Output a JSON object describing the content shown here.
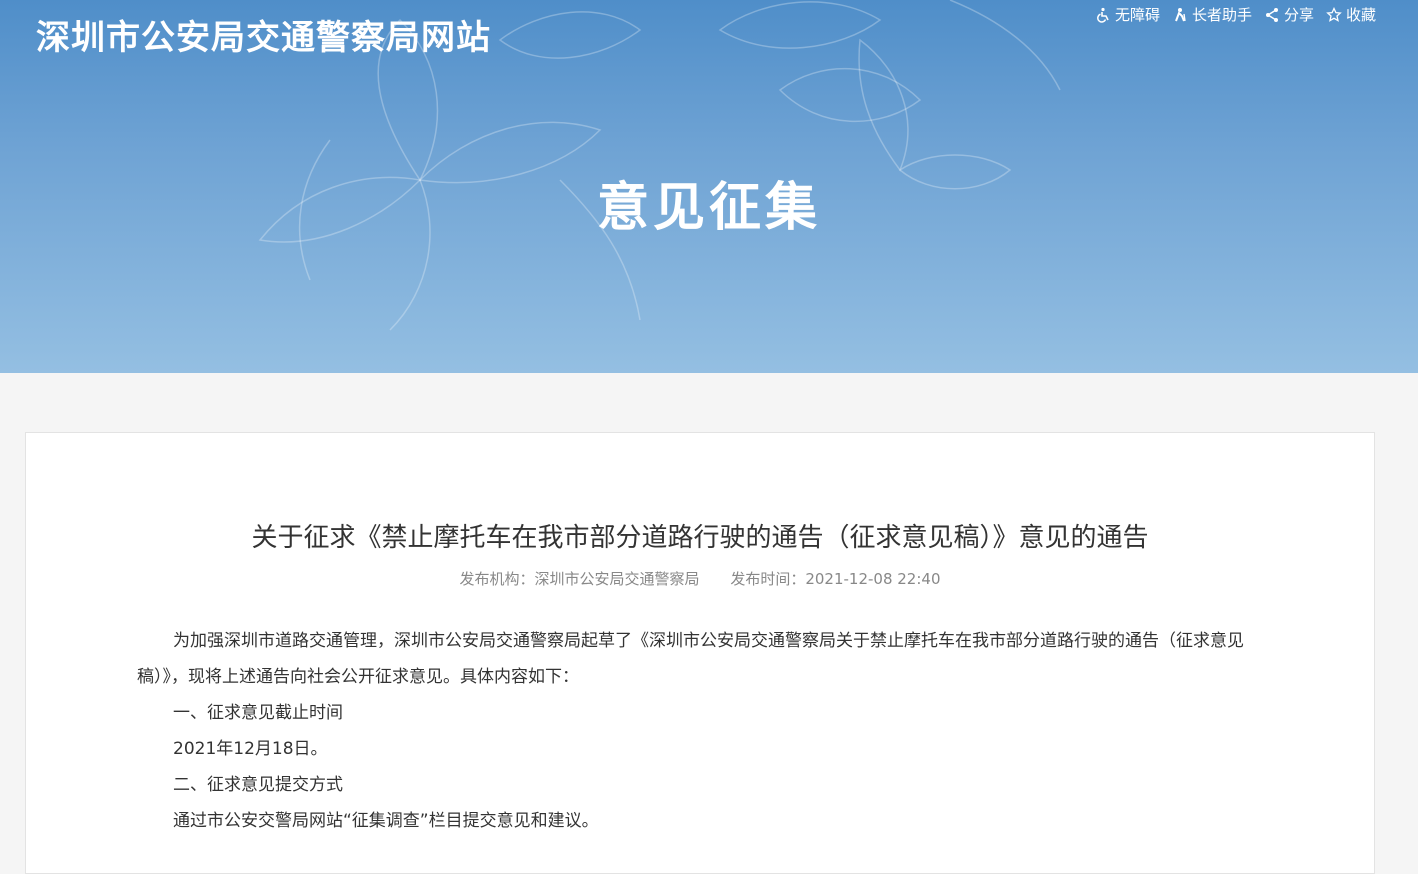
{
  "header": {
    "site_title": "深圳市公安局交通警察局网站",
    "banner_heading": "意见征集",
    "toolbar": [
      {
        "label": "无障碍",
        "icon": "wheelchair-icon"
      },
      {
        "label": "长者助手",
        "icon": "elder-helper-icon"
      },
      {
        "label": "分享",
        "icon": "share-icon"
      },
      {
        "label": "收藏",
        "icon": "star-icon"
      }
    ]
  },
  "article": {
    "title": "关于征求《禁止摩托车在我市部分道路行驶的通告（征求意见稿）》意见的通告",
    "publisher": "发布机构：深圳市公安局交通警察局",
    "publish_time": "发布时间：2021-12-08 22:40",
    "paragraph_1": "为加强深圳市道路交通管理，深圳市公安局交通警察局起草了《深圳市公安局交通警察局关于禁止摩托车在我市部分道路行驶的通告（征求意见稿）》，现将上述通告向社会公开征求意见。具体内容如下：",
    "section_1_heading": "一、征求意见截止时间",
    "section_1_body": "2021年12月18日。",
    "section_2_heading": "二、征求意见提交方式",
    "section_2_body": "通过市公安交警局网站“征集调查”栏目提交意见和建议。"
  },
  "colors": {
    "banner_top": "#4f8ec9",
    "banner_bottom": "#94bfe2",
    "page_bg": "#f5f5f5",
    "text": "#333333",
    "meta_text": "#888888"
  }
}
